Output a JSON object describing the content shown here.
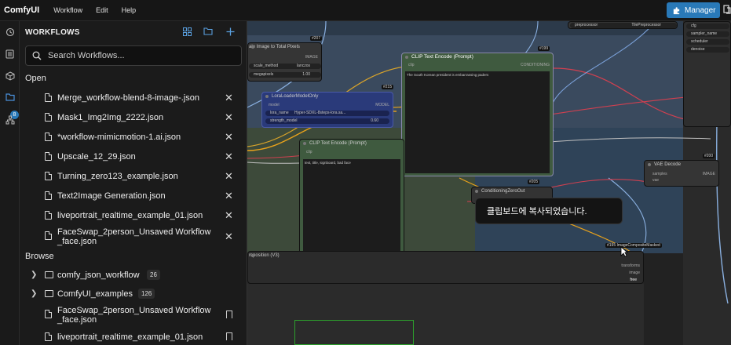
{
  "app": {
    "brand": "ComfyUI",
    "menu": [
      "Workflow",
      "Edit",
      "Help"
    ],
    "manager_label": "Manager"
  },
  "rail": {
    "queue_badge": "8",
    "icons": [
      "history-icon",
      "queue-icon",
      "node-library-icon",
      "workflows-icon",
      "model-library-icon"
    ]
  },
  "panel": {
    "title": "WORKFLOWS",
    "search_placeholder": "Search Workflows...",
    "open_label": "Open",
    "open_items": [
      "Merge_workflow-blend-8-image-.json",
      "Mask1_Img2Img_2222.json",
      "*workflow-mimicmotion-1.ai.json",
      "Upscale_12_29.json",
      "Turning_zero123_example.json",
      "Text2Image Generation.json",
      "liveportrait_realtime_example_01.json",
      "FaceSwap_2person_Unsaved Workflow _face.json"
    ],
    "browse_label": "Browse",
    "browse_folders": [
      {
        "name": "comfy_json_workflow",
        "count": "26"
      },
      {
        "name": "ComfyUI_examples",
        "count": "126"
      }
    ],
    "browse_items": [
      "FaceSwap_2person_Unsaved Workflow _face.json",
      "liveportrait_realtime_example_01.json"
    ]
  },
  "canvas": {
    "toast": "클립보드에 복사되었습니다.",
    "nodes": {
      "scale": {
        "id": "#207",
        "title": "ale Image to Total Pixels",
        "port_out": "IMAGE",
        "w1_label": "scale_method",
        "w1_value": "lanczos",
        "w2_label": "megapixels",
        "w2_value": "1.00"
      },
      "lora": {
        "id": "#215",
        "title": "LoraLoaderModelOnly",
        "port_in": "model",
        "port_out": "MODEL",
        "w1_label": "lora_name",
        "w1_value": "Hyper-SDXL-8steps-lora.sa...",
        "w2_label": "strength_model",
        "w2_value": "0.60"
      },
      "clip_pos": {
        "id": "#199",
        "title": "CLIP Text Encode (Prompt)",
        "port_in": "clip",
        "port_out": "CONDITIONING",
        "text": "The South Korean president is embarrassing paders"
      },
      "clip_neg": {
        "title": "CLIP Text Encode (Prompt)",
        "port_in": "clip",
        "text": "text, title, signboard, bad face"
      },
      "cond_zero": {
        "id": "#205",
        "title": "ConditioningZeroOut"
      },
      "vae": {
        "id": "#200",
        "title": "VAE Decode",
        "port_in1": "samples",
        "port_in2": "vae",
        "port_out": "IMAGE"
      },
      "tile": {
        "label": "preprocessor",
        "value": "TilePreprocessor"
      },
      "sampler_list": [
        "cfg",
        "sampler_name",
        "scheduler",
        "denoise"
      ],
      "compose": {
        "id": "#195",
        "title": "ImageCompositeMasked",
        "title_short": "mposition (V3)",
        "port_1": "transforms",
        "port_2": "image",
        "port_3": "free"
      }
    }
  },
  "colors": {
    "accent": "#2979b8",
    "green_group": "#3f5a3f",
    "blue_group": "#2f4358",
    "lora_node": "#2a3a7a"
  }
}
